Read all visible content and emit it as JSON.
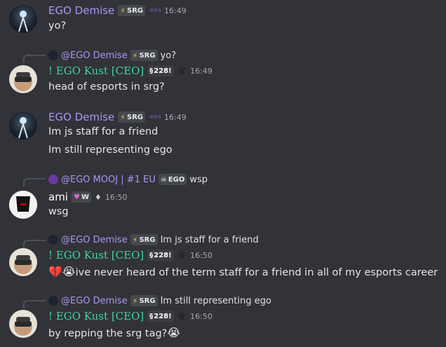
{
  "messages": [
    {
      "author": "EGO Demise",
      "tag": "SRG",
      "extra": "ଏଏଏ",
      "time": "16:49",
      "lines": [
        "yo?"
      ]
    },
    {
      "reply": {
        "author": "@EGO Demise",
        "tag": "SRG",
        "text": "yo?"
      },
      "author": "! EGO Kust [CEO]",
      "badge": "228!",
      "time": "16:49",
      "lines": [
        "head of esports in srg?"
      ]
    },
    {
      "author": "EGO Demise",
      "tag": "SRG",
      "extra": "ଏଏଏ",
      "time": "16:49",
      "lines": [
        "Im js staff for a friend",
        "Im still representing ego"
      ]
    },
    {
      "reply": {
        "author": "@EGO MOOJ | #1 EU",
        "tag": "EGO",
        "text": "wsp"
      },
      "author": "ami",
      "badge": "W",
      "time": "16:50",
      "lines": [
        "wsg"
      ]
    },
    {
      "reply": {
        "author": "@EGO Demise",
        "tag": "SRG",
        "text": "Im js staff for a friend"
      },
      "author": "! EGO Kust [CEO]",
      "badge": "228!",
      "time": "16:50",
      "lines": [
        "ive never heard of the term staff for a friend in all of my esports career"
      ]
    },
    {
      "reply": {
        "author": "@EGO Demise",
        "tag": "SRG",
        "text": "Im still representing ego"
      },
      "author": "! EGO Kust [CEO]",
      "badge": "228!",
      "time": "16:50",
      "lines": [
        "by repping the srg tag?"
      ]
    }
  ],
  "colors": {
    "background": "#323339",
    "demise_name": "#a996f0",
    "kust_name": "#3fd3a0",
    "ami_name": "#ffffff"
  }
}
